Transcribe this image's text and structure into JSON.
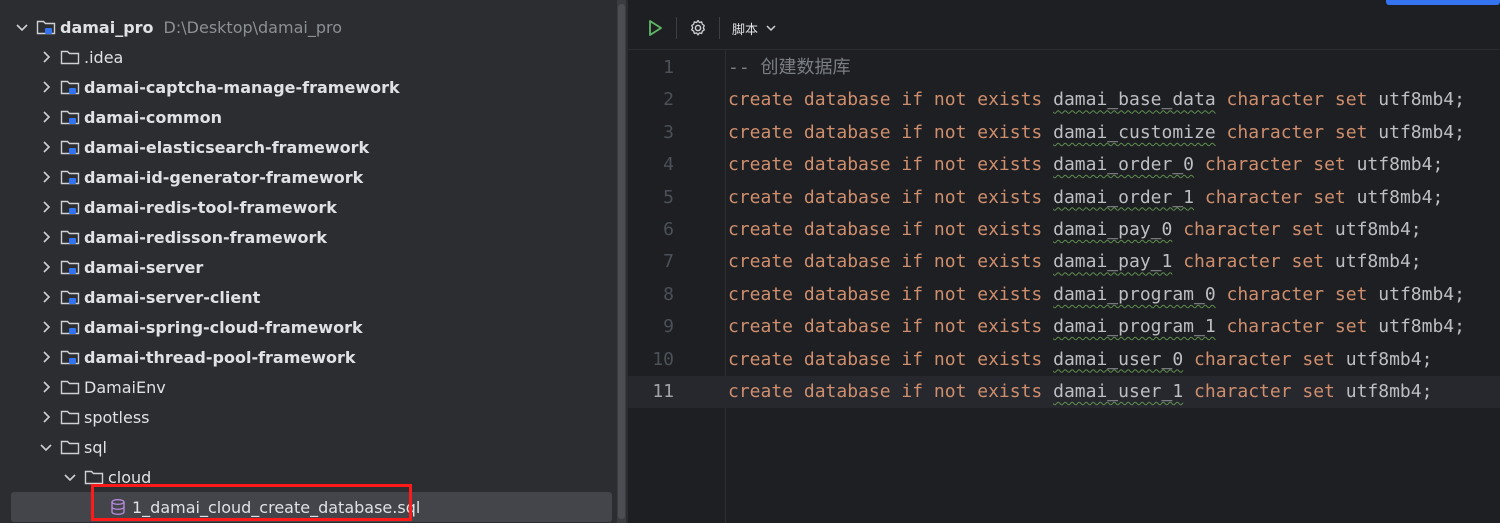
{
  "project_tree": {
    "root": {
      "name": "damai_pro",
      "path": "D:\\Desktop\\damai_pro"
    },
    "items": [
      {
        "label": ".idea",
        "bold": false,
        "depth": 1,
        "expanded": false
      },
      {
        "label": "damai-captcha-manage-framework",
        "bold": true,
        "depth": 1,
        "expanded": false
      },
      {
        "label": "damai-common",
        "bold": true,
        "depth": 1,
        "expanded": false
      },
      {
        "label": "damai-elasticsearch-framework",
        "bold": true,
        "depth": 1,
        "expanded": false
      },
      {
        "label": "damai-id-generator-framework",
        "bold": true,
        "depth": 1,
        "expanded": false
      },
      {
        "label": "damai-redis-tool-framework",
        "bold": true,
        "depth": 1,
        "expanded": false
      },
      {
        "label": "damai-redisson-framework",
        "bold": true,
        "depth": 1,
        "expanded": false
      },
      {
        "label": "damai-server",
        "bold": true,
        "depth": 1,
        "expanded": false
      },
      {
        "label": "damai-server-client",
        "bold": true,
        "depth": 1,
        "expanded": false
      },
      {
        "label": "damai-spring-cloud-framework",
        "bold": true,
        "depth": 1,
        "expanded": false
      },
      {
        "label": "damai-thread-pool-framework",
        "bold": true,
        "depth": 1,
        "expanded": false
      },
      {
        "label": "DamaiEnv",
        "bold": false,
        "depth": 1,
        "expanded": false
      },
      {
        "label": "spotless",
        "bold": false,
        "depth": 1,
        "expanded": false
      },
      {
        "label": "sql",
        "bold": false,
        "depth": 1,
        "expanded": true
      },
      {
        "label": "cloud",
        "bold": false,
        "depth": 2,
        "expanded": true
      },
      {
        "label": "1_damai_cloud_create_database.sql",
        "bold": false,
        "depth": 3,
        "file": true,
        "selected": true
      }
    ]
  },
  "toolbar": {
    "run_icon": "play-icon",
    "settings_icon": "gear-icon",
    "script_label": "脚本",
    "dropdown_icon": "chevron-down-icon"
  },
  "editor": {
    "current_line": 11,
    "lines": [
      {
        "n": "1",
        "comment": "-- 创建数据库"
      },
      {
        "n": "2",
        "kw1": "create database if not exists",
        "db": "damai_base_data",
        "kw2": "character set",
        "tail": "utf8mb4;"
      },
      {
        "n": "3",
        "kw1": "create database if not exists",
        "db": "damai_customize",
        "kw2": "character set",
        "tail": "utf8mb4;"
      },
      {
        "n": "4",
        "kw1": "create database if not exists",
        "db": "damai_order_0",
        "kw2": "character set",
        "tail": "utf8mb4;"
      },
      {
        "n": "5",
        "kw1": "create database if not exists",
        "db": "damai_order_1",
        "kw2": "character set",
        "tail": "utf8mb4;"
      },
      {
        "n": "6",
        "kw1": "create database if not exists",
        "db": "damai_pay_0",
        "kw2": "character set",
        "tail": "utf8mb4;"
      },
      {
        "n": "7",
        "kw1": "create database if not exists",
        "db": "damai_pay_1",
        "kw2": "character set",
        "tail": "utf8mb4;"
      },
      {
        "n": "8",
        "kw1": "create database if not exists",
        "db": "damai_program_0",
        "kw2": "character set",
        "tail": "utf8mb4;"
      },
      {
        "n": "9",
        "kw1": "create database if not exists",
        "db": "damai_program_1",
        "kw2": "character set",
        "tail": "utf8mb4;"
      },
      {
        "n": "10",
        "kw1": "create database if not exists",
        "db": "damai_user_0",
        "kw2": "character set",
        "tail": "utf8mb4;"
      },
      {
        "n": "11",
        "kw1": "create database if not exists",
        "db": "damai_user_1",
        "kw2": "character set",
        "tail": "utf8mb4;"
      }
    ]
  },
  "colors": {
    "keyword": "#cf8e6d",
    "comment": "#7a7e85",
    "text": "#bcbec4",
    "selection_box": "#ff1a1a",
    "accent": "#3574f0"
  }
}
